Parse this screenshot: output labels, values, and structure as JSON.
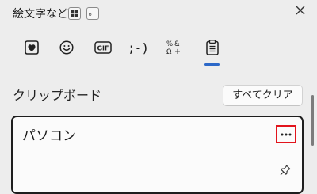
{
  "header": {
    "title": "絵文字など",
    "kbd_period": "。"
  },
  "tabs": [
    {
      "name": "kaomoji-heart",
      "icon": "heart-card-icon"
    },
    {
      "name": "emoji",
      "icon": "smiley-icon"
    },
    {
      "name": "gif",
      "icon": "gif-icon",
      "label": "GIF"
    },
    {
      "name": "kaomoji",
      "label": ";-)"
    },
    {
      "name": "symbols",
      "icon": "symbols-icon"
    },
    {
      "name": "clipboard",
      "icon": "clipboard-icon",
      "active": true
    }
  ],
  "clipboard": {
    "section_label": "クリップボード",
    "clear_all_label": "すべてクリア",
    "items": [
      {
        "text": "パソコン"
      }
    ]
  },
  "colors": {
    "accent": "#2c68c8",
    "highlight": "#e2141c",
    "background": "#ededed"
  }
}
